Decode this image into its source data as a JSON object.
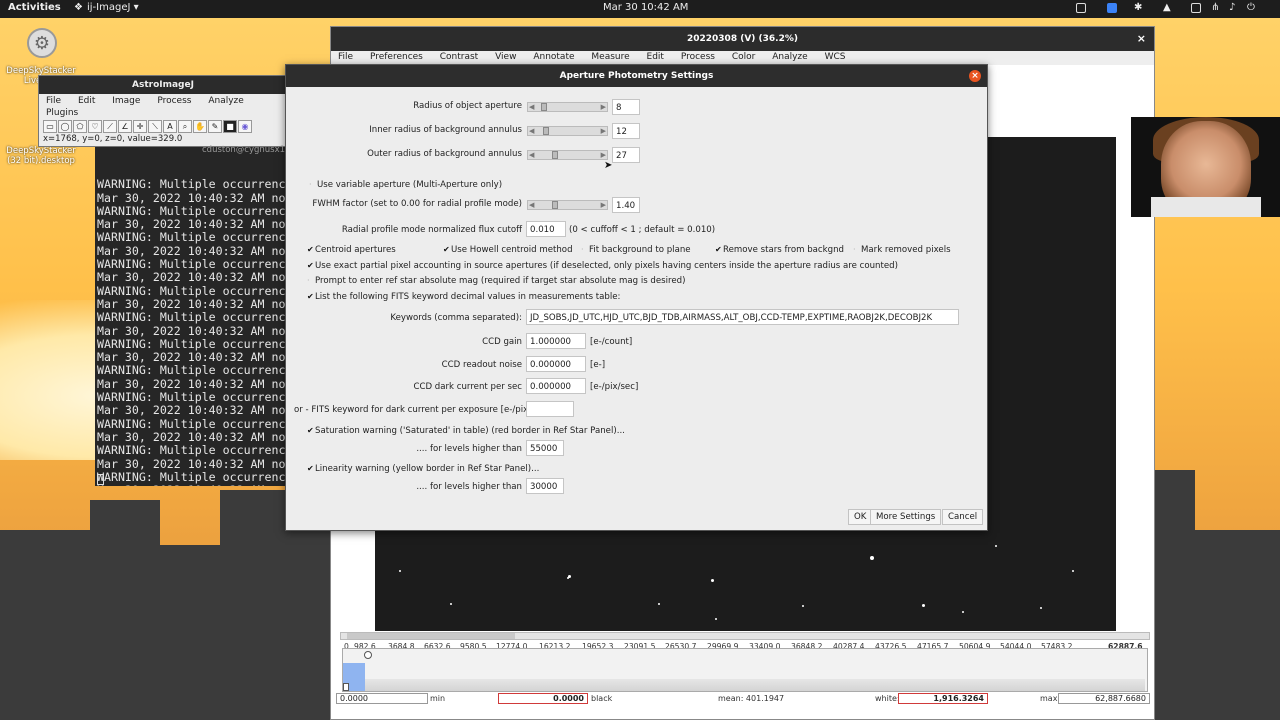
{
  "topbar": {
    "activities": "Activities",
    "app_name": "ij-ImageJ",
    "datetime": "Mar 30  10:42 AM"
  },
  "desktop": {
    "icon1_label": "DeepSkyStacker Live (32",
    "icon2_label": "DeepSkyStacker (32 bit).desktop"
  },
  "image_window": {
    "title": "20220308 (V) (36.2%)",
    "menu": [
      "File",
      "Preferences",
      "Contrast",
      "View",
      "Annotate",
      "Measure",
      "Edit",
      "Process",
      "Color",
      "Analyze",
      "WCS"
    ],
    "histogram": {
      "ticks": [
        "0",
        "982.6",
        "3684.8",
        "6632.6",
        "9580.5",
        "12774.0",
        "16213.2",
        "19652.3",
        "23091.5",
        "26530.7",
        "29969.9",
        "33409.0",
        "36848.2",
        "40287.4",
        "43726.5",
        "47165.7",
        "50604.9",
        "54044.0",
        "57483.2",
        "62887.6"
      ],
      "min_value": "0.0000",
      "min_label": "min",
      "black_value": "0.0000",
      "black_label": "black",
      "mean_text": "mean: 401.1947",
      "white_label": "white:",
      "white_value": "1,916.3264",
      "max_label": "max:",
      "max_value": "62,887.6680"
    }
  },
  "astroimagej": {
    "title": "AstroImageJ",
    "menu": [
      "File",
      "Edit",
      "Image",
      "Process",
      "Analyze",
      "Plugins"
    ],
    "status": "x=1768, y=0, z=0, value=329.0",
    "user_host": "cduston@cygnusx1"
  },
  "terminal": {
    "lines": [
      "WARNING: Multiple occurrence",
      "Mar 30, 2022 10:40:32 AM nom",
      "WARNING: Multiple occurrence",
      "Mar 30, 2022 10:40:32 AM nom",
      "WARNING: Multiple occurrence",
      "Mar 30, 2022 10:40:32 AM nom",
      "WARNING: Multiple occurrence",
      "Mar 30, 2022 10:40:32 AM nom",
      "WARNING: Multiple occurrence",
      "Mar 30, 2022 10:40:32 AM nom",
      "WARNING: Multiple occurrence",
      "Mar 30, 2022 10:40:32 AM nom",
      "WARNING: Multiple occurrence",
      "Mar 30, 2022 10:40:32 AM nom",
      "WARNING: Multiple occurrence",
      "Mar 30, 2022 10:40:32 AM nom",
      "WARNING: Multiple occurrence",
      "Mar 30, 2022 10:40:32 AM nom",
      "WARNING: Multiple occurrence",
      "Mar 30, 2022 10:40:32 AM nom",
      "WARNING: Multiple occurrence",
      "Mar 30, 2022 10:40:32 AM nom",
      "WARNING: Multiple occurrence",
      "Mar 30, 2022 10:40:32 AM nom",
      "WARNING: Multiple occurrence"
    ]
  },
  "dialog": {
    "title": "Aperture Photometry Settings",
    "radius_label": "Radius of object aperture",
    "radius_value": "8",
    "inner_label": "Inner radius of background annulus",
    "inner_value": "12",
    "outer_label": "Outer radius of background annulus",
    "outer_value": "27",
    "variable_aperture": "Use variable aperture (Multi-Aperture only)",
    "fwhm_label": "FWHM factor (set to 0.00 for radial profile mode)",
    "fwhm_value": "1.40",
    "radial_label": "Radial profile mode normalized flux cutoff",
    "radial_value": "0.010",
    "radial_hint": "(0 < cuffoff < 1 ; default = 0.010)",
    "centroid": "Centroid apertures",
    "howell": "Use Howell centroid method",
    "fit_bg": "Fit background to plane",
    "remove_stars": "Remove stars from backgnd",
    "mark_removed": "Mark removed pixels",
    "exact_partial": "Use exact partial pixel accounting in source apertures (if deselected, only pixels having centers inside the aperture radius are counted)",
    "prompt_ref": "Prompt to enter ref star absolute mag (required if target star absolute mag is desired)",
    "list_fits": "List the following FITS keyword decimal values in measurements table:",
    "keywords_label": "Keywords (comma separated):",
    "keywords_value": "JD_SOBS,JD_UTC,HJD_UTC,BJD_TDB,AIRMASS,ALT_OBJ,CCD-TEMP,EXPTIME,RAOBJ2K,DECOBJ2K",
    "gain_label": "CCD gain",
    "gain_value": "1.000000",
    "gain_unit": "[e-/count]",
    "readout_label": "CCD readout noise",
    "readout_value": "0.000000",
    "readout_unit": "[e-]",
    "dark_label": "CCD dark current per sec",
    "dark_value": "0.000000",
    "dark_unit": "[e-/pix/sec]",
    "fits_dark_label": "or - FITS keyword for dark current per exposure [e-/pix]",
    "fits_dark_value": "",
    "saturation": "Saturation warning ('Saturated' in table) (red border in Ref Star Panel)...",
    "sat_levels_label": ".... for levels higher than",
    "sat_levels_value": "55000",
    "linearity": "Linearity warning (yellow border in Ref Star Panel)...",
    "lin_levels_label": ".... for levels higher than",
    "lin_levels_value": "30000",
    "ok": "OK",
    "more_settings": "More Settings",
    "cancel": "Cancel",
    "check": "✔"
  },
  "colors": {
    "accent_close": "#e95420",
    "titlebar": "#2d2d2d",
    "desktop": "#ffc04a"
  }
}
